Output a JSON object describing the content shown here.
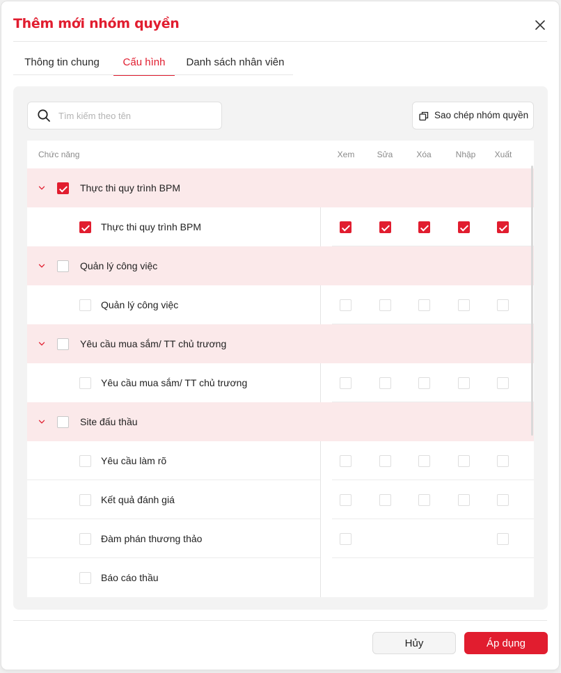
{
  "modal": {
    "title": "Thêm mới nhóm quyền",
    "close_icon": "close-icon"
  },
  "tabs": [
    {
      "label": "Thông tin chung",
      "active": false
    },
    {
      "label": "Cấu hình",
      "active": true
    },
    {
      "label": "Danh sách nhân viên",
      "active": false
    }
  ],
  "search": {
    "placeholder": "Tìm kiếm theo tên",
    "value": "",
    "icon": "search-icon"
  },
  "copy_button": {
    "label": "Sao chép nhóm quyền",
    "icon": "copy-icon"
  },
  "table": {
    "headers": {
      "function": "Chức năng",
      "view": "Xem",
      "edit": "Sửa",
      "delete": "Xóa",
      "import": "Nhập",
      "export": "Xuất"
    },
    "groups": [
      {
        "label": "Thực thi quy trình BPM",
        "checked": true,
        "expanded": true,
        "items": [
          {
            "label": "Thực thi quy trình BPM",
            "checked": true,
            "perms": [
              true,
              true,
              true,
              true,
              true
            ],
            "available": [
              true,
              true,
              true,
              true,
              true
            ]
          }
        ]
      },
      {
        "label": "Quản lý công việc",
        "checked": false,
        "expanded": true,
        "items": [
          {
            "label": "Quản lý công việc",
            "checked": false,
            "perms": [
              false,
              false,
              false,
              false,
              false
            ],
            "available": [
              true,
              true,
              true,
              true,
              true
            ]
          }
        ]
      },
      {
        "label": "Yêu cầu mua sắm/ TT chủ trương",
        "checked": false,
        "expanded": true,
        "items": [
          {
            "label": "Yêu cầu mua sắm/ TT chủ trương",
            "checked": false,
            "perms": [
              false,
              false,
              false,
              false,
              false
            ],
            "available": [
              true,
              true,
              true,
              true,
              true
            ]
          }
        ]
      },
      {
        "label": "Site đấu thầu",
        "checked": false,
        "expanded": true,
        "items": [
          {
            "label": "Yêu cầu làm rõ",
            "checked": false,
            "perms": [
              false,
              false,
              false,
              false,
              false
            ],
            "available": [
              true,
              true,
              true,
              true,
              true
            ]
          },
          {
            "label": "Kết quả đánh giá",
            "checked": false,
            "perms": [
              false,
              false,
              false,
              false,
              false
            ],
            "available": [
              true,
              true,
              true,
              true,
              true
            ]
          },
          {
            "label": "Đàm phán thương thảo",
            "checked": false,
            "perms": [
              false,
              false,
              false,
              false,
              false
            ],
            "available": [
              true,
              false,
              false,
              false,
              true
            ]
          },
          {
            "label": "Báo cáo thầu",
            "checked": false,
            "perms": [
              false,
              false,
              false,
              false,
              false
            ],
            "available": [
              false,
              false,
              false,
              false,
              false
            ]
          }
        ]
      }
    ]
  },
  "footer": {
    "cancel_label": "Hủy",
    "apply_label": "Áp dụng"
  },
  "colors": {
    "accent": "#e11d2f",
    "group_row_bg": "#fbe9ea",
    "panel_bg": "#f3f3f3"
  }
}
